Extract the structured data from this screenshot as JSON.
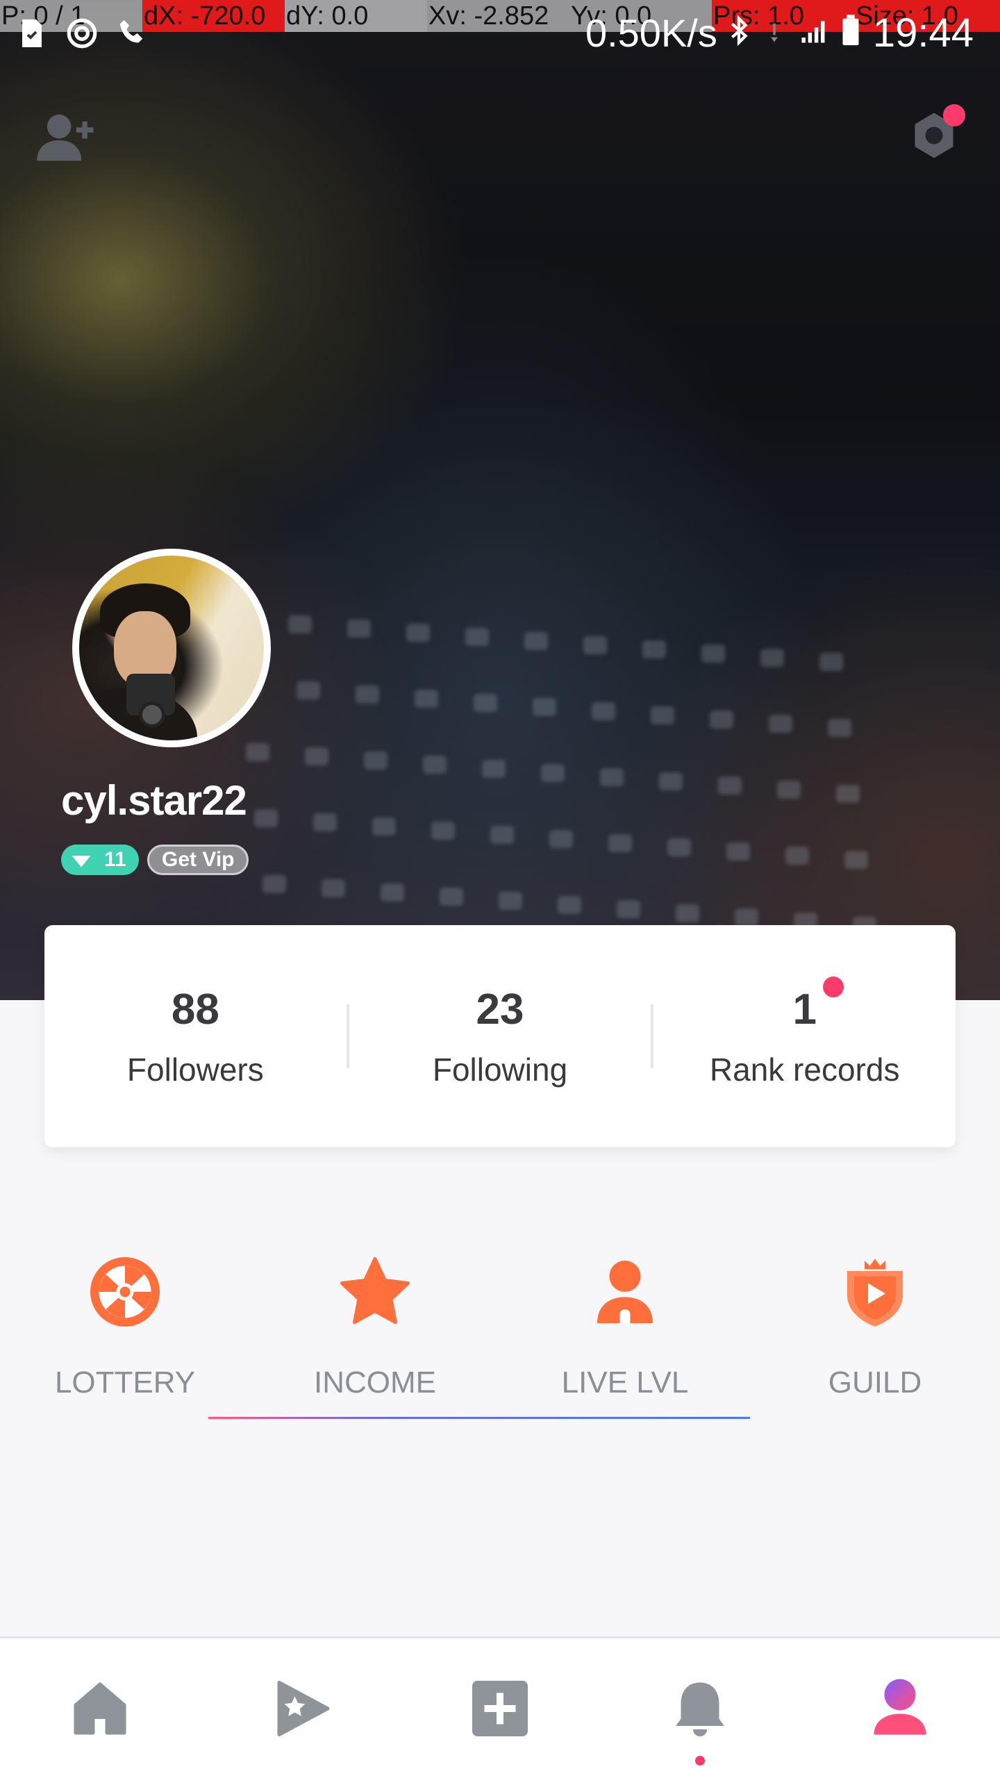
{
  "status_bar": {
    "debug": {
      "pointer": "P: 0 / 1",
      "dx": "dX: -720.0",
      "dy": "dY: 0.0",
      "xv": "Xv: -2.852",
      "yv": "Yv: 0.0",
      "prs": "Prs: 1.0",
      "size": "Size: 1.0"
    },
    "net_speed": "0.50K/s",
    "time": "19:44"
  },
  "profile": {
    "username": "cyl.star22",
    "level": "11",
    "vip_label": "Get Vip"
  },
  "stats": [
    {
      "value": "88",
      "label": "Followers"
    },
    {
      "value": "23",
      "label": "Following"
    },
    {
      "value": "1",
      "label": "Rank records"
    }
  ],
  "features": [
    {
      "label": "LOTTERY",
      "icon": "lottery-wheel-icon"
    },
    {
      "label": "INCOME",
      "icon": "star-icon"
    },
    {
      "label": "LIVE LVL",
      "icon": "person-icon"
    },
    {
      "label": "GUILD",
      "icon": "guild-shield-icon"
    }
  ],
  "bottom_nav": [
    {
      "icon": "home-icon"
    },
    {
      "icon": "play-star-icon"
    },
    {
      "icon": "add-icon"
    },
    {
      "icon": "bell-icon"
    },
    {
      "icon": "profile-icon"
    }
  ],
  "colors": {
    "accent_orange": "#ff6f3c",
    "notification_red": "#ff3b6b",
    "level_teal": "#3fd3b4"
  }
}
